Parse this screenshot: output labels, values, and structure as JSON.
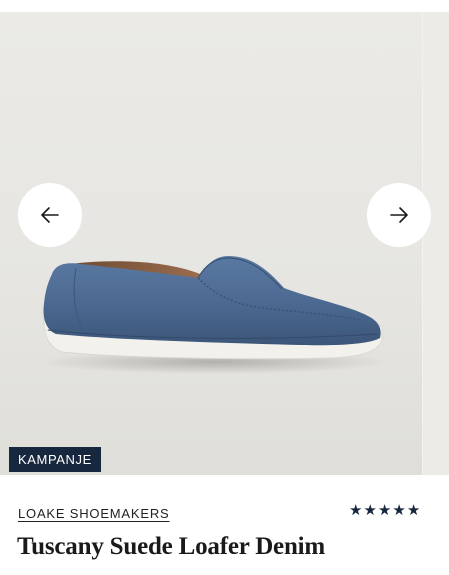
{
  "gallery": {
    "badge_label": "KAMPANJE",
    "image_alt": "Tuscany Suede Loafer Denim",
    "prev_icon": "arrow-left-icon",
    "next_icon": "arrow-right-icon",
    "colors": {
      "background": "#e7e6e2",
      "shoe_suede": "#4b6890",
      "sole": "#f2f1ec",
      "badge": "#16273e"
    }
  },
  "product": {
    "brand": "LOAKE SHOEMAKERS",
    "title": "Tuscany Suede Loafer Denim",
    "rating": {
      "value": 5,
      "max": 5,
      "icon": "star-icon",
      "color": "#16273e"
    }
  }
}
